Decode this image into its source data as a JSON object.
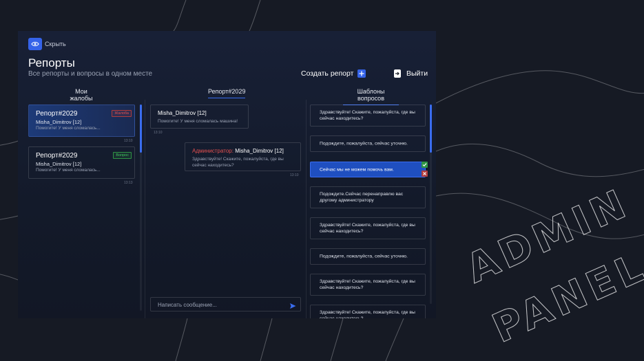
{
  "header": {
    "hide_label": "Скрыть",
    "title": "Репорты",
    "subtitle": "Все репорты и вопросы в одном месте",
    "create_label": "Создать репорт",
    "exit_label": "Выйти"
  },
  "tabs": {
    "complaints": "Мои жалобы",
    "report": "Репорт#2029",
    "templates": "Шаблоны вопросов"
  },
  "reports": [
    {
      "title": "Репорт#2029",
      "user": "Misha_Dimitrov [12]",
      "message": "Помогите! У меня сломалась...",
      "badge": "Жалоба",
      "time": "13:10"
    },
    {
      "title": "Репорт#2029",
      "user": "Misha_Dimitrov [12]",
      "message": "Помогите! У меня сломалась...",
      "badge": "Вопрос",
      "time": "13:13"
    }
  ],
  "chat": {
    "messages": [
      {
        "author": "Misha_Dimitrov [12]",
        "text": "Помогите! У меня сломалась машина!",
        "time": "13:10"
      },
      {
        "role": "Администратор:",
        "author": "Misha_Dimitrov [12]",
        "text": "Здравствуйте! Скажите, пожалуйста, где вы сейчас находитесь?",
        "time": "13:10"
      }
    ],
    "input_placeholder": "Написать сообщение..."
  },
  "templates": [
    "Здравствуйте! Скажите, пожалуйста, где вы сейчас находитесь?",
    "Подождите, пожалуйста, сейчас уточню.",
    "Сейчас мы не можем помочь вам.",
    "Подождите.Сейчас перенаправлю вас другому администратору",
    "Здравствуйте! Скажите, пожалуйста, где вы сейчас находитесь?",
    "Подождите, пожалуйста, сейчас уточню.",
    "Здравствуйте! Скажите, пожалуйста, где вы сейчас находитесь?",
    "Здравствуйте! Скажите, пожалуйста, где вы сейчас находитесь?"
  ],
  "watermark": {
    "line1": "ADMIN",
    "line2": "PANEL"
  },
  "colors": {
    "accent": "#3563e9",
    "danger": "#e2504f",
    "success": "#3fc45c",
    "background": "#161a24"
  }
}
